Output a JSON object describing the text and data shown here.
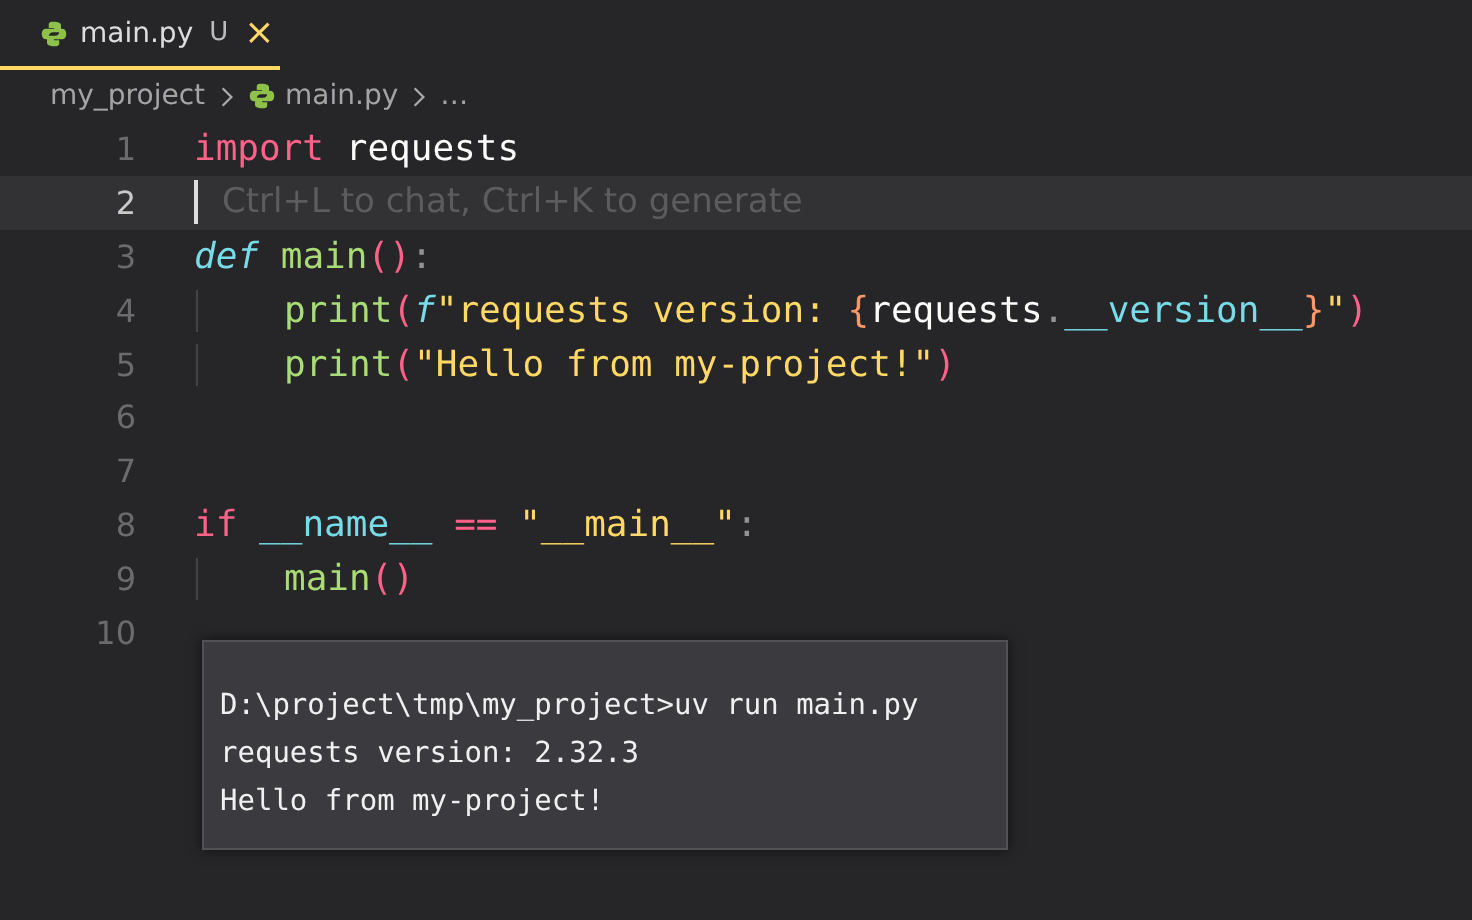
{
  "tabs": [
    {
      "label": "main.py",
      "status": "U",
      "close": "×",
      "selected": true
    }
  ],
  "breadcrumb": [
    {
      "label": "my_project",
      "kind": "folder"
    },
    {
      "label": "main.py",
      "kind": "file"
    },
    {
      "label": "…",
      "kind": "more"
    }
  ],
  "lines": [
    {
      "number": "1",
      "selected": false,
      "indented": false,
      "tokens": [
        {
          "text": "import ",
          "kind": "kw"
        },
        {
          "text": "requests",
          "kind": "plain"
        }
      ]
    },
    {
      "number": "2",
      "selected": true,
      "indented": false,
      "hint": "Ctrl+L to chat, Ctrl+K to generate"
    },
    {
      "number": "3",
      "selected": false,
      "indented": false,
      "tokens": [
        {
          "text": "def ",
          "kind": "storage"
        },
        {
          "text": "main",
          "kind": "fn"
        },
        {
          "text": "()",
          "kind": "paren"
        },
        {
          "text": ":",
          "kind": "colon"
        }
      ]
    },
    {
      "number": "4",
      "selected": false,
      "indented": true,
      "tokens": [
        {
          "text": "print",
          "kind": "fn"
        },
        {
          "text": "(",
          "kind": "paren"
        },
        {
          "text": "f",
          "kind": "storage"
        },
        {
          "text": "\"requests version: ",
          "kind": "str"
        },
        {
          "text": "{",
          "kind": "brace"
        },
        {
          "text": "requests",
          "kind": "plain"
        },
        {
          "text": ".",
          "kind": "colon"
        },
        {
          "text": "__version__",
          "kind": "prop"
        },
        {
          "text": "}",
          "kind": "brace"
        },
        {
          "text": "\"",
          "kind": "str"
        },
        {
          "text": ")",
          "kind": "paren"
        }
      ]
    },
    {
      "number": "5",
      "selected": false,
      "indented": true,
      "tokens": [
        {
          "text": "print",
          "kind": "fn"
        },
        {
          "text": "(",
          "kind": "paren"
        },
        {
          "text": "\"Hello from my-project!\"",
          "kind": "str"
        },
        {
          "text": ")",
          "kind": "paren"
        }
      ]
    },
    {
      "number": "6",
      "selected": false,
      "indented": false
    },
    {
      "number": "7",
      "selected": false,
      "indented": false
    },
    {
      "number": "8",
      "selected": false,
      "indented": false,
      "tokens": [
        {
          "text": "if ",
          "kind": "kw"
        },
        {
          "text": "__name__ ",
          "kind": "prop"
        },
        {
          "text": "== ",
          "kind": "kw"
        },
        {
          "text": "\"__main__\"",
          "kind": "str"
        },
        {
          "text": ":",
          "kind": "colon"
        }
      ]
    },
    {
      "number": "9",
      "selected": false,
      "indented": true,
      "tokens": [
        {
          "text": "main",
          "kind": "fn"
        },
        {
          "text": "()",
          "kind": "paren"
        }
      ]
    },
    {
      "number": "10",
      "selected": false,
      "indented": false
    }
  ],
  "terminal_popup": {
    "lines": [
      "D:\\project\\tmp\\my_project>uv run main.py",
      "requests version: 2.32.3",
      "Hello from my-project!"
    ]
  }
}
